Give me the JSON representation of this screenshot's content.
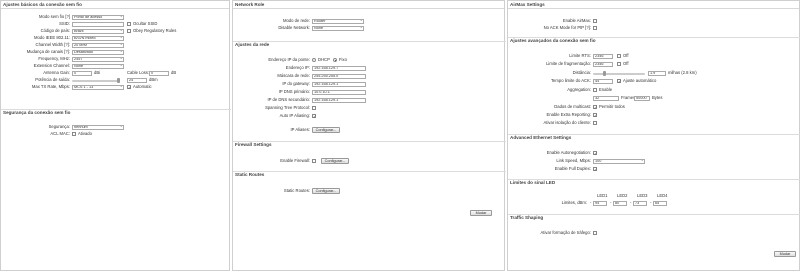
{
  "wireless": {
    "title": "Ajustes básicos da conexão sem fio",
    "mode_label": "Modo sem fio [?]",
    "mode_value": "Ponto de acesso",
    "ssid_label": "SSID:",
    "ssid_value": "",
    "hide_ssid": "Ocultar SSID",
    "country_label": "Código de país:",
    "country_value": "Brazil",
    "obey_reg": "Obey Regulatory Rules",
    "ieee_label": "Modo IEEE 802.11:",
    "ieee_value": "B/G/N mixed",
    "width_label": "Channel Width [?]:",
    "width_value": "20 MHz",
    "channel_change_label": "Mudança de canais [?]:",
    "channel_change_value": "Desativado",
    "freq_label": "Frequency, MHz:",
    "freq_value": "2457",
    "ext_label": "Extension Channel:",
    "ext_value": "None",
    "gain_label": "Antenna Gain:",
    "gain_value": "0",
    "gain_unit": "dBi",
    "cable_label": "Cable Loss:",
    "cable_value": "0",
    "cable_unit": "dB",
    "power_label": "Potência de saída:",
    "power_value": "24",
    "power_unit": "dBm",
    "rate_label": "Max TX Rate, Mbps:",
    "rate_value": "MCS 1 - 13",
    "auto": "Automatic"
  },
  "security": {
    "title": "Segurança da conexão sem fio",
    "sec_label": "Segurança:",
    "sec_value": "nenhum",
    "acl_label": "ACL MAC:",
    "acl_check": "Ativado"
  },
  "network": {
    "title": "Network Role",
    "mode_label": "Modo de rede:",
    "mode_value": "Router",
    "disable_label": "Disable Network:",
    "disable_value": "None",
    "ajustes_title": "Ajustes da rede",
    "addr_label": "Endereço IP da ponte:",
    "dhcp": "DHCP",
    "fixed": "Fixo",
    "ip_label": "Endereço IP:",
    "ip_value": "192.168.129.7",
    "mask_label": "Máscara de rede:",
    "mask_value": "255.255.255.0",
    "gw_label": "IP do gateway:",
    "gw_value": "192.168.129.1",
    "dns1_label": "IP DNS primário:",
    "dns1_value": "10.0.10.1",
    "dns2_label": "IP de DNS secundário:",
    "dns2_value": "192.168.129.1",
    "stp_label": "Spanning Tree Protocol:",
    "aliasing_label": "Auto IP Aliasing:",
    "ipaliases_label": "IP Aliases:",
    "configure": "Configurar...",
    "firewall_title": "Firewall Settings",
    "enable_fw_label": "Enable Firewall:",
    "static_title": "Static Routes",
    "static_label": "Static Routes:",
    "save": "Mudar"
  },
  "airmax": {
    "title": "AirMax Settings",
    "enable_label": "Enable AirMax:",
    "noack_label": "No ACK Mode for PtP [?]:"
  },
  "advanced": {
    "title": "Ajustes avançados da conexão sem fio",
    "rts_label": "Limite RTS:",
    "rts_value": "2346",
    "off1": "Off",
    "frag_label": "Limite de fragmentação:",
    "frag_value": "2346",
    "off2": "Off",
    "dist_label": "Distância:",
    "dist_value": "1.9",
    "dist_unit": "milhas (2.8 km)",
    "ack_label": "Tempo limite do ACK:",
    "ack_value": "44",
    "ack_auto": "Ajuste automático",
    "agg_label": "Aggregation:",
    "agg_enable": "Enable",
    "agg_frames": "32",
    "frames": "Frames",
    "agg_bytes": "50000",
    "bytes": "Bytes",
    "mcast_label": "Dados de multicast:",
    "mcast_check": "Permitir todos",
    "extra_label": "Enable Extra Reporting:",
    "isolate_label": "Ativar isolação do cliente:"
  },
  "ethernet": {
    "title": "Advanced Ethernet Settings",
    "autoneg_label": "Enable Autonegotiation:",
    "speed_label": "Link Speed, Mbps:",
    "speed_value": "100",
    "duplex_label": "Enable Full Duplex:"
  },
  "leds": {
    "title": "Limites do sinal LED",
    "led1": "LED1",
    "led2": "LED2",
    "led3": "LED3",
    "led4": "LED4",
    "limits_label": "Limites, dBm:",
    "v1": "94",
    "v2": "80",
    "v3": "73",
    "v4": "65"
  },
  "traffic": {
    "title": "Traffic Shaping",
    "enable_label": "Ativar formação de tráfego:",
    "save": "Mudar"
  }
}
